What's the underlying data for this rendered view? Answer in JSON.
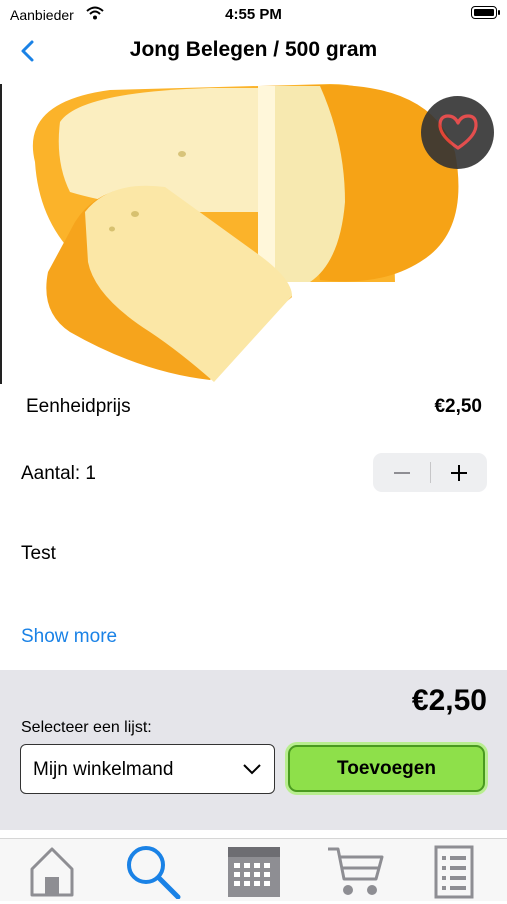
{
  "status_bar": {
    "carrier": "Aanbieder",
    "time": "4:55 PM"
  },
  "nav": {
    "title": "Jong Belegen / 500 gram"
  },
  "product": {
    "unit_price_label": "Eenheidprijs",
    "unit_price": "€2,50",
    "quantity_label": "Aantal: 1",
    "description": "Test",
    "show_more": "Show more"
  },
  "footer": {
    "total": "€2,50",
    "list_label": "Selecteer een lijst:",
    "selected_list": "Mijn winkelmand",
    "add_button": "Toevoegen"
  },
  "colors": {
    "accent": "#1a82e6",
    "add_button": "#8ee04a",
    "favorite_heart": "#e03b3b"
  },
  "tabs": [
    {
      "icon": "home-icon"
    },
    {
      "icon": "search-icon",
      "active": true
    },
    {
      "icon": "calendar-icon"
    },
    {
      "icon": "cart-icon"
    },
    {
      "icon": "list-icon"
    }
  ]
}
